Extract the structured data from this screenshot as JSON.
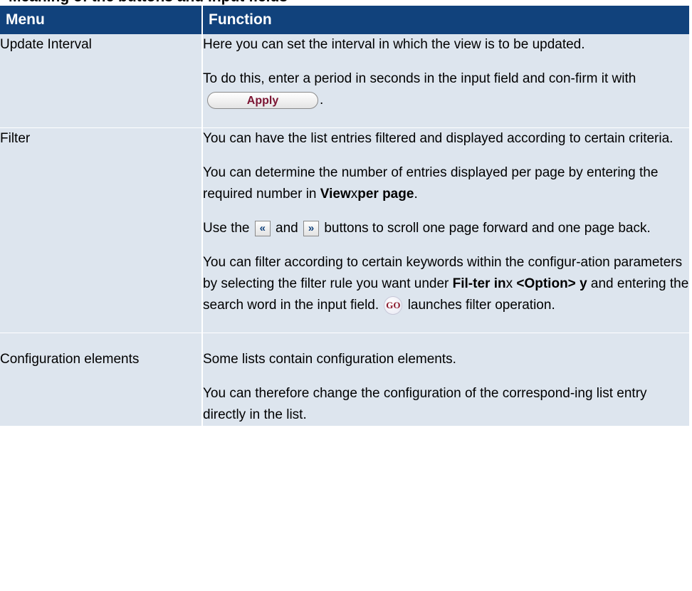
{
  "page_top_text": "Meaning of the buttons and input fields",
  "table": {
    "headers": [
      "Menu",
      "Function"
    ],
    "rows": {
      "update_interval": {
        "menu": "Update Interval",
        "p1": "Here you can set the interval in which the view is to be updated.",
        "p2_before": "To do this, enter a period in seconds in the input field and con-firm it with",
        "p2_button": "Apply",
        "p2_after": "."
      },
      "filter": {
        "menu": "Filter",
        "p1": "You can have the list entries filtered and displayed according to certain criteria.",
        "p2_before": "You can determine the number of entries displayed per page by entering the required number in",
        "p2_bold_view": "View",
        "p2_x": "x",
        "p2_bold_perpage": "per page",
        "p2_after": ".",
        "p3_before": "Use the",
        "p3_prev_icon": "«",
        "p3_mid": "and",
        "p3_next_icon": "»",
        "p3_after": "buttons to scroll one page forward and one page back.",
        "p4_before": "You can filter according to certain keywords within the configur-ation parameters by selecting the filter rule you want under",
        "p4_bold_filterin": "Fil-ter in",
        "p4_x": "x",
        "p4_bold_option": "<Option>",
        "p4_bold_y": "y",
        "p4_mid": "and entering the search word in the input field.",
        "p4_go": "GO",
        "p4_after": "launches filter operation."
      },
      "configuration": {
        "menu": "Configuration elements",
        "p1": "Some lists contain configuration elements.",
        "p2": "You can therefore change the configuration of the correspond-ing list entry directly in the list."
      }
    }
  }
}
